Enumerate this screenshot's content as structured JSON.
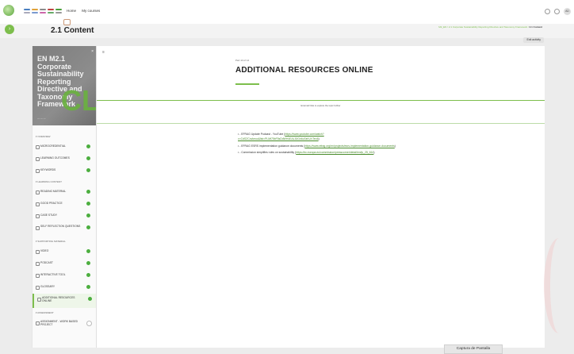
{
  "colors": {
    "accent": "#7dbe4c",
    "link": "#4a8c2c",
    "done": "#4cae3f"
  },
  "topnav": {
    "home": "Home",
    "courses": "My courses",
    "avatar": "AD"
  },
  "header": {
    "title": "2.1 Content",
    "breadcrumb_course": "M2_EN",
    "breadcrumb_section": "2.1 Corporate Sustainability Reporting Directive and Taxonomy Framework",
    "breadcrumb_current": "2.1 Content",
    "exit_label": "Exit activity"
  },
  "cover": {
    "title": "EN M2.1 Corporate Sustainability Reporting Directive and Taxonomy Framework",
    "mark": "CL"
  },
  "sidebar": {
    "items": [
      {
        "type": "section",
        "label": "Overview"
      },
      {
        "type": "item",
        "label": "Microcredential",
        "done": true
      },
      {
        "type": "item",
        "label": "Learning outcomes",
        "done": true
      },
      {
        "type": "item",
        "label": "Keywords",
        "done": true
      },
      {
        "type": "section",
        "label": "Learning content"
      },
      {
        "type": "item",
        "label": "Reading material",
        "done": true
      },
      {
        "type": "item",
        "label": "Good practice",
        "done": true
      },
      {
        "type": "item",
        "label": "Case study",
        "done": true
      },
      {
        "type": "item",
        "label": "Self reflection questions",
        "done": true
      },
      {
        "type": "section",
        "label": "Supporting material"
      },
      {
        "type": "item",
        "label": "Video",
        "done": true
      },
      {
        "type": "item",
        "label": "Podcast",
        "done": true
      },
      {
        "type": "item",
        "label": "Interactive tool",
        "done": true
      },
      {
        "type": "item",
        "label": "Glossary",
        "done": true
      },
      {
        "type": "item",
        "label": "Additional resources online",
        "done": true,
        "active": true
      },
      {
        "type": "section",
        "label": "Assessment"
      },
      {
        "type": "item",
        "label": "Assignment - work based project",
        "done": false
      }
    ]
  },
  "content": {
    "part": "Part 13 of 14",
    "title": "ADDITIONAL RESOURCES ONLINE",
    "band": "External links to explore the topic further",
    "links": [
      {
        "text": "EFRAG Update Podcast - YouTube",
        "url": "https://www.youtube.com/watch?v=CdSZCovkeuo&list=PLMt75bF5sDdWH4EAL30Gn6uTaKUVTeo6"
      },
      {
        "text": "EFRAG ESRS implementation guidance documents",
        "url": "https://www.efrag.org/en/projects/esrs-implementation-guidance-documents"
      },
      {
        "text": "Commission simplifies rules on sustainability",
        "url": "https://ec.europa.eu/commission/presscorner/detail/en/ip_25_614"
      }
    ]
  },
  "taskbar": {
    "caption": "Captura de Pantalla"
  }
}
